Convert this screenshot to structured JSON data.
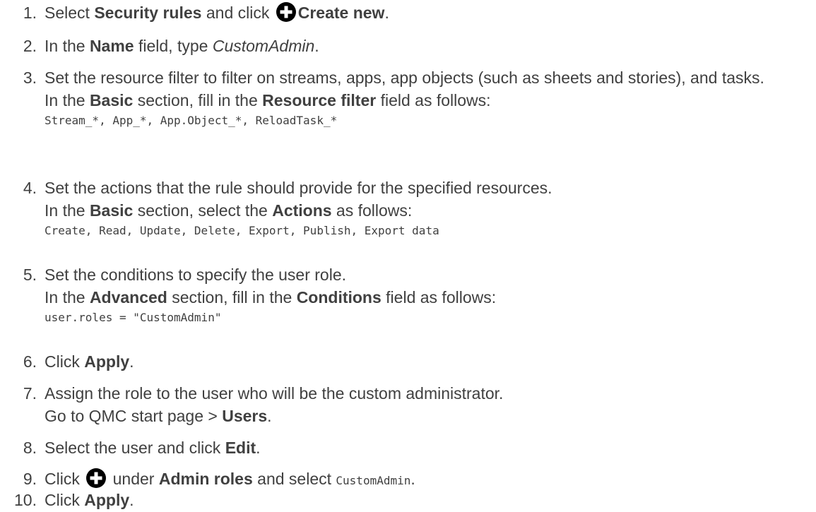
{
  "steps": [
    {
      "num": "1.",
      "a": "Select ",
      "b": "Security rules",
      "c": " and click ",
      "d": "Create new",
      "e": "."
    },
    {
      "num": "2.",
      "a": "In the ",
      "b": "Name",
      "c": " field, type ",
      "d": "CustomAdmin",
      "e": "."
    },
    {
      "num": "3.",
      "text": "Set the resource filter to filter on streams, apps, app objects (such as sheets and stories), and tasks.",
      "a": "In the ",
      "b": "Basic",
      "c": " section, fill in the ",
      "d": "Resource filter",
      "e": " field as follows:",
      "code": "Stream_*, App_*, App.Object_*, ReloadTask_*"
    },
    {
      "num": "4.",
      "text": "Set the actions that the rule should provide for the specified resources.",
      "a": "In the ",
      "b": "Basic",
      "c": " section, select the ",
      "d": "Actions",
      "e": " as follows:",
      "code": "Create, Read, Update, Delete, Export, Publish, Export data"
    },
    {
      "num": "5.",
      "text": "Set the conditions to specify the user role.",
      "a": "In the ",
      "b": "Advanced",
      "c": " section, fill in the ",
      "d": "Conditions",
      "e": " field as follows:",
      "code": "user.roles = \"CustomAdmin\""
    },
    {
      "num": "6.",
      "a": "Click ",
      "b": "Apply",
      "c": "."
    },
    {
      "num": "7.",
      "text": "Assign the role to the user who will be the custom administrator.",
      "a": "Go to QMC start page > ",
      "b": "Users",
      "c": "."
    },
    {
      "num": "8.",
      "a": "Select the user and click ",
      "b": "Edit",
      "c": "."
    },
    {
      "num": "9.",
      "a": "Click ",
      "b": " under ",
      "c": "Admin roles",
      "d": " and select ",
      "code": "CustomAdmin",
      "e": "."
    },
    {
      "num": "10.",
      "a": "Click ",
      "b": "Apply",
      "c": "."
    }
  ],
  "icons": {
    "plus": "plus-circle-icon",
    "color": "#000000"
  }
}
